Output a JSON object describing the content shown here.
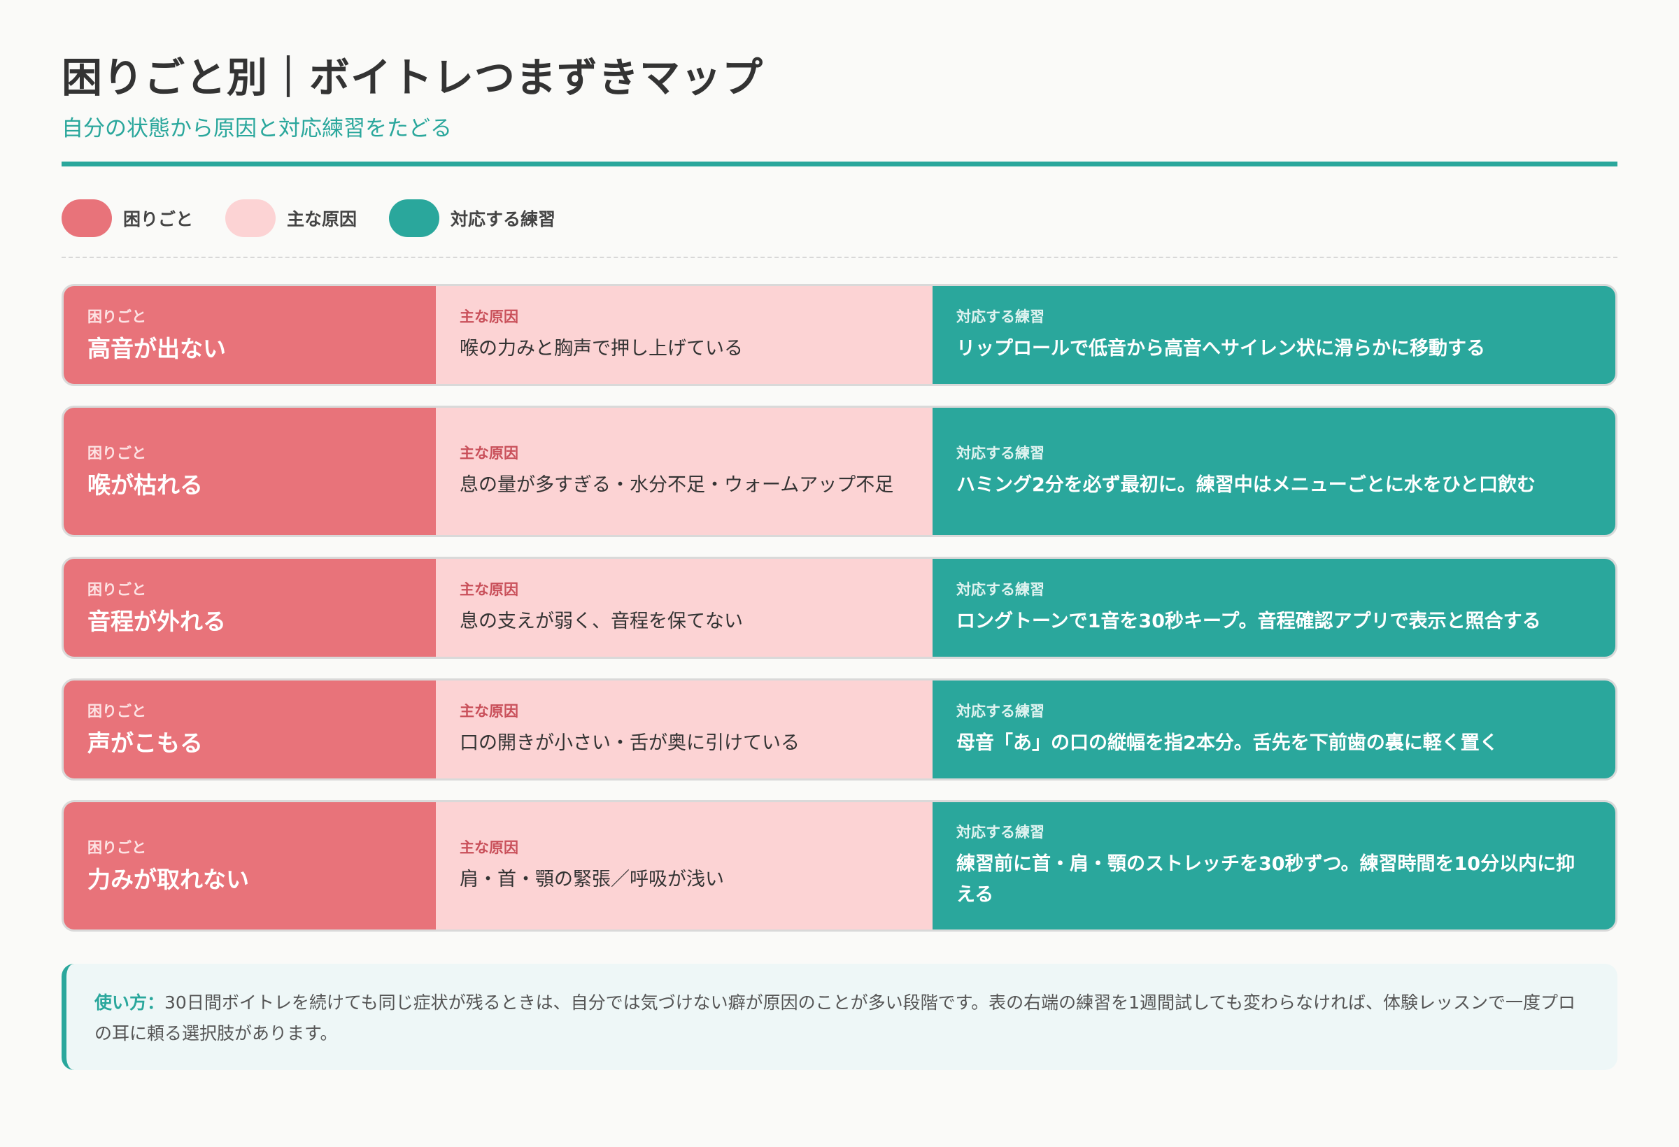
{
  "header": {
    "title": "困りごと別｜ボイトレつまずきマップ",
    "subtitle": "自分の状態から原因と対応練習をたどる"
  },
  "legend": {
    "problem": "困りごと",
    "cause": "主な原因",
    "practice": "対応する練習"
  },
  "colors": {
    "problem": "#e8737a",
    "cause": "#fcd3d4",
    "practice": "#2aa79c"
  },
  "rows": [
    {
      "problem_tag": "困りごと",
      "problem": "高音が出ない",
      "cause_tag": "主な原因",
      "cause": "喉の力みと胸声で押し上げている",
      "practice_tag": "対応する練習",
      "practice": "リップロールで低音から高音へサイレン状に滑らかに移動する"
    },
    {
      "problem_tag": "困りごと",
      "problem": "喉が枯れる",
      "cause_tag": "主な原因",
      "cause": "息の量が多すぎる・水分不足・ウォームアップ不足",
      "practice_tag": "対応する練習",
      "practice": "ハミング2分を必ず最初に。練習中はメニューごとに水をひと口飲む"
    },
    {
      "problem_tag": "困りごと",
      "problem": "音程が外れる",
      "cause_tag": "主な原因",
      "cause": "息の支えが弱く、音程を保てない",
      "practice_tag": "対応する練習",
      "practice": "ロングトーンで1音を30秒キープ。音程確認アプリで表示と照合する"
    },
    {
      "problem_tag": "困りごと",
      "problem": "声がこもる",
      "cause_tag": "主な原因",
      "cause": "口の開きが小さい・舌が奥に引けている",
      "practice_tag": "対応する練習",
      "practice": "母音「あ」の口の縦幅を指2本分。舌先を下前歯の裏に軽く置く"
    },
    {
      "problem_tag": "困りごと",
      "problem": "力みが取れない",
      "cause_tag": "主な原因",
      "cause": "肩・首・顎の緊張／呼吸が浅い",
      "practice_tag": "対応する練習",
      "practice": "練習前に首・肩・顎のストレッチを30秒ずつ。練習時間を10分以内に抑える"
    }
  ],
  "note": {
    "label": "使い方：",
    "text": "30日間ボイトレを続けても同じ症状が残るときは、自分では気づけない癖が原因のことが多い段階です。表の右端の練習を1週間試しても変わらなければ、体験レッスンで一度プロの耳に頼る選択肢があります。"
  }
}
